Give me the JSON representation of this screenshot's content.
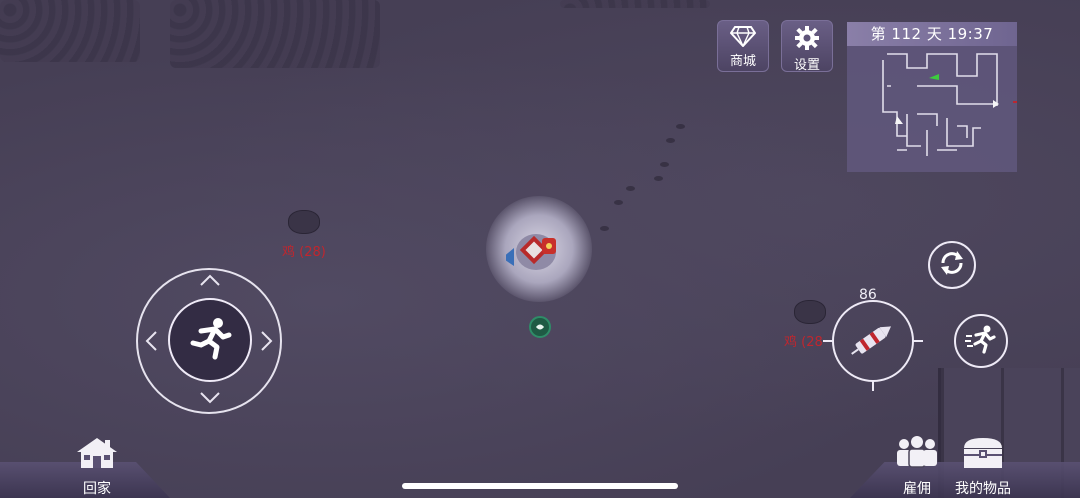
{
  "hud": {
    "shop": {
      "label": "商城",
      "icon": "diamond-icon"
    },
    "settings": {
      "label": "设置",
      "icon": "gear-icon"
    },
    "status": {
      "text": "第 112 天  19:37"
    }
  },
  "minimap": {
    "icon": "minimap"
  },
  "joystick": {
    "icon": "sprint-runner-icon"
  },
  "enemies": [
    {
      "label": "鸡 (28)"
    },
    {
      "label": "鸡 (28"
    }
  ],
  "actions": {
    "attack_count": "86",
    "refresh_icon": "refresh-icon",
    "sprint_icon": "sprint-icon"
  },
  "bottom": {
    "home": {
      "label": "回家",
      "icon": "house-icon"
    },
    "hire": {
      "label": "雇佣",
      "icon": "people-icon"
    },
    "inventory": {
      "label": "我的物品",
      "icon": "chest-icon"
    }
  },
  "colors": {
    "ground": "#463f55",
    "enemy_label": "#c0262e",
    "hud_button": "#5d5378"
  }
}
